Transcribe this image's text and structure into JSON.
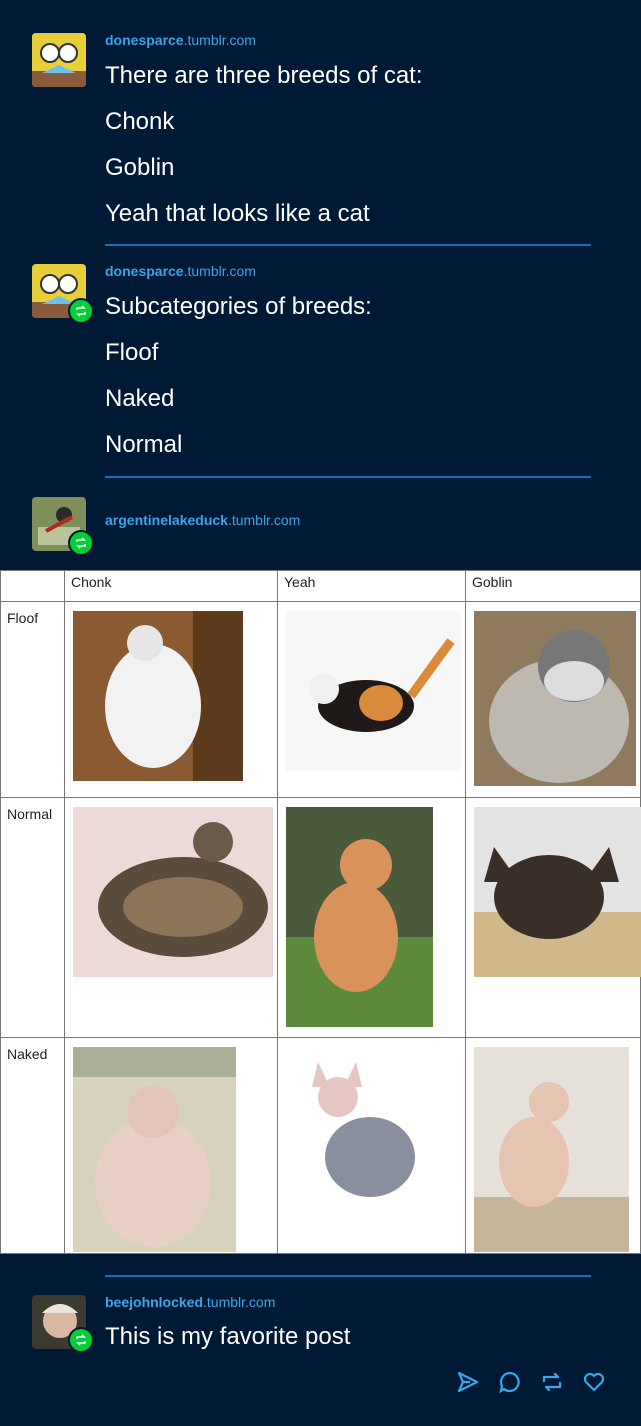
{
  "posts": [
    {
      "user_name": "donesparce",
      "user_domain": ".tumblr.com",
      "lines": [
        "There are three breeds of cat:",
        "Chonk",
        "Goblin",
        "Yeah that looks like a cat"
      ]
    },
    {
      "user_name": "donesparce",
      "user_domain": ".tumblr.com",
      "lines": [
        "Subcategories of breeds:",
        "Floof",
        "Naked",
        "Normal"
      ]
    },
    {
      "user_name": "argentinelakeduck",
      "user_domain": ".tumblr.com"
    },
    {
      "user_name": "beejohnlocked",
      "user_domain": ".tumblr.com",
      "lines": [
        "This is my favorite post"
      ]
    }
  ],
  "table": {
    "columns": [
      "Chonk",
      "Yeah",
      "Goblin"
    ],
    "rows": [
      "Floof",
      "Normal",
      "Naked"
    ]
  },
  "actions": [
    "share-icon",
    "reply-icon",
    "reblog-icon",
    "like-icon"
  ],
  "colors": {
    "background": "#001935",
    "link": "#3aa6e8",
    "reblog": "#00cf35",
    "divider": "#1e6fb5"
  }
}
